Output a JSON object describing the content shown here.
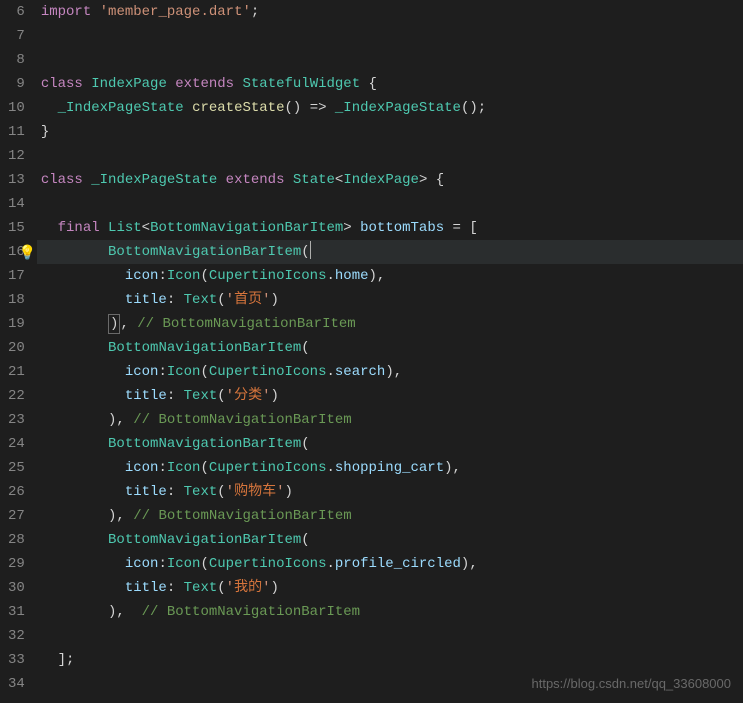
{
  "lines": [
    {
      "num": 6,
      "indent": 0,
      "tokens": [
        [
          "kw",
          "import"
        ],
        [
          "pnc",
          " "
        ],
        [
          "str-quote",
          "'member_page.dart'"
        ],
        [
          "pnc",
          ";"
        ]
      ]
    },
    {
      "num": 7,
      "indent": 0,
      "tokens": []
    },
    {
      "num": 8,
      "indent": 0,
      "tokens": []
    },
    {
      "num": 9,
      "indent": 0,
      "tokens": [
        [
          "kw",
          "class"
        ],
        [
          "pnc",
          " "
        ],
        [
          "cls",
          "IndexPage"
        ],
        [
          "pnc",
          " "
        ],
        [
          "kw",
          "extends"
        ],
        [
          "pnc",
          " "
        ],
        [
          "cls",
          "StatefulWidget"
        ],
        [
          "pnc",
          " {"
        ]
      ]
    },
    {
      "num": 10,
      "indent": 1,
      "tokens": [
        [
          "cls",
          "_IndexPageState"
        ],
        [
          "pnc",
          " "
        ],
        [
          "fn",
          "createState"
        ],
        [
          "pnc",
          "() => "
        ],
        [
          "cls",
          "_IndexPageState"
        ],
        [
          "pnc",
          "();"
        ]
      ]
    },
    {
      "num": 11,
      "indent": 0,
      "tokens": [
        [
          "pnc",
          "}"
        ]
      ]
    },
    {
      "num": 12,
      "indent": 0,
      "tokens": []
    },
    {
      "num": 13,
      "indent": 0,
      "tokens": [
        [
          "kw",
          "class"
        ],
        [
          "pnc",
          " "
        ],
        [
          "cls",
          "_IndexPageState"
        ],
        [
          "pnc",
          " "
        ],
        [
          "kw",
          "extends"
        ],
        [
          "pnc",
          " "
        ],
        [
          "cls",
          "State"
        ],
        [
          "pnc",
          "<"
        ],
        [
          "cls",
          "IndexPage"
        ],
        [
          "pnc",
          "> {"
        ]
      ]
    },
    {
      "num": 14,
      "indent": 0,
      "tokens": []
    },
    {
      "num": 15,
      "indent": 1,
      "tokens": [
        [
          "kw",
          "final"
        ],
        [
          "pnc",
          " "
        ],
        [
          "cls",
          "List"
        ],
        [
          "pnc",
          "<"
        ],
        [
          "cls",
          "BottomNavigationBarItem"
        ],
        [
          "pnc",
          "> "
        ],
        [
          "var",
          "bottomTabs"
        ],
        [
          "pnc",
          " = ["
        ]
      ]
    },
    {
      "num": 16,
      "indent": 4,
      "highlighted": true,
      "lightbulb": true,
      "tokens": [
        [
          "cls",
          "BottomNavigationBarItem"
        ],
        [
          "pnc",
          "("
        ],
        [
          "cursor",
          ""
        ]
      ]
    },
    {
      "num": 17,
      "indent": 5,
      "tokens": [
        [
          "param",
          "icon"
        ],
        [
          "pnc",
          ":"
        ],
        [
          "cls",
          "Icon"
        ],
        [
          "pnc",
          "("
        ],
        [
          "cls",
          "CupertinoIcons"
        ],
        [
          "pnc",
          "."
        ],
        [
          "var",
          "home"
        ],
        [
          "pnc",
          "),"
        ]
      ]
    },
    {
      "num": 18,
      "indent": 5,
      "tokens": [
        [
          "param",
          "title"
        ],
        [
          "pnc",
          ": "
        ],
        [
          "cls",
          "Text"
        ],
        [
          "pnc",
          "("
        ],
        [
          "str-quote",
          "'"
        ],
        [
          "str-orange",
          "首页"
        ],
        [
          "str-quote",
          "'"
        ],
        [
          "pnc",
          ")"
        ]
      ]
    },
    {
      "num": 19,
      "indent": 4,
      "tokens": [
        [
          "box",
          ")"
        ],
        [
          "pnc",
          ", "
        ],
        [
          "cmt",
          "// BottomNavigationBarItem"
        ]
      ]
    },
    {
      "num": 20,
      "indent": 4,
      "tokens": [
        [
          "cls",
          "BottomNavigationBarItem"
        ],
        [
          "pnc",
          "("
        ]
      ]
    },
    {
      "num": 21,
      "indent": 5,
      "tokens": [
        [
          "param",
          "icon"
        ],
        [
          "pnc",
          ":"
        ],
        [
          "cls",
          "Icon"
        ],
        [
          "pnc",
          "("
        ],
        [
          "cls",
          "CupertinoIcons"
        ],
        [
          "pnc",
          "."
        ],
        [
          "var",
          "search"
        ],
        [
          "pnc",
          "),"
        ]
      ]
    },
    {
      "num": 22,
      "indent": 5,
      "tokens": [
        [
          "param",
          "title"
        ],
        [
          "pnc",
          ": "
        ],
        [
          "cls",
          "Text"
        ],
        [
          "pnc",
          "("
        ],
        [
          "str-quote",
          "'"
        ],
        [
          "str-orange",
          "分类"
        ],
        [
          "str-quote",
          "'"
        ],
        [
          "pnc",
          ")"
        ]
      ]
    },
    {
      "num": 23,
      "indent": 4,
      "tokens": [
        [
          "pnc",
          "), "
        ],
        [
          "cmt",
          "// BottomNavigationBarItem"
        ]
      ]
    },
    {
      "num": 24,
      "indent": 4,
      "tokens": [
        [
          "cls",
          "BottomNavigationBarItem"
        ],
        [
          "pnc",
          "("
        ]
      ]
    },
    {
      "num": 25,
      "indent": 5,
      "tokens": [
        [
          "param",
          "icon"
        ],
        [
          "pnc",
          ":"
        ],
        [
          "cls",
          "Icon"
        ],
        [
          "pnc",
          "("
        ],
        [
          "cls",
          "CupertinoIcons"
        ],
        [
          "pnc",
          "."
        ],
        [
          "var",
          "shopping_cart"
        ],
        [
          "pnc",
          "),"
        ]
      ]
    },
    {
      "num": 26,
      "indent": 5,
      "tokens": [
        [
          "param",
          "title"
        ],
        [
          "pnc",
          ": "
        ],
        [
          "cls",
          "Text"
        ],
        [
          "pnc",
          "("
        ],
        [
          "str-quote",
          "'"
        ],
        [
          "str-orange",
          "购物车"
        ],
        [
          "str-quote",
          "'"
        ],
        [
          "pnc",
          ")"
        ]
      ]
    },
    {
      "num": 27,
      "indent": 4,
      "tokens": [
        [
          "pnc",
          "), "
        ],
        [
          "cmt",
          "// BottomNavigationBarItem"
        ]
      ]
    },
    {
      "num": 28,
      "indent": 4,
      "tokens": [
        [
          "cls",
          "BottomNavigationBarItem"
        ],
        [
          "pnc",
          "("
        ]
      ]
    },
    {
      "num": 29,
      "indent": 5,
      "tokens": [
        [
          "param",
          "icon"
        ],
        [
          "pnc",
          ":"
        ],
        [
          "cls",
          "Icon"
        ],
        [
          "pnc",
          "("
        ],
        [
          "cls",
          "CupertinoIcons"
        ],
        [
          "pnc",
          "."
        ],
        [
          "var",
          "profile_circled"
        ],
        [
          "pnc",
          "),"
        ]
      ]
    },
    {
      "num": 30,
      "indent": 5,
      "tokens": [
        [
          "param",
          "title"
        ],
        [
          "pnc",
          ": "
        ],
        [
          "cls",
          "Text"
        ],
        [
          "pnc",
          "("
        ],
        [
          "str-quote",
          "'"
        ],
        [
          "str-orange",
          "我的"
        ],
        [
          "str-quote",
          "'"
        ],
        [
          "pnc",
          ")"
        ]
      ]
    },
    {
      "num": 31,
      "indent": 4,
      "tokens": [
        [
          "pnc",
          "),  "
        ],
        [
          "cmt",
          "// BottomNavigationBarItem"
        ]
      ]
    },
    {
      "num": 32,
      "indent": 0,
      "tokens": []
    },
    {
      "num": 33,
      "indent": 1,
      "tokens": [
        [
          "pnc",
          "];"
        ]
      ]
    },
    {
      "num": 34,
      "indent": 0,
      "cut": true,
      "tokens": []
    }
  ],
  "watermark": "https://blog.csdn.net/qq_33608000"
}
